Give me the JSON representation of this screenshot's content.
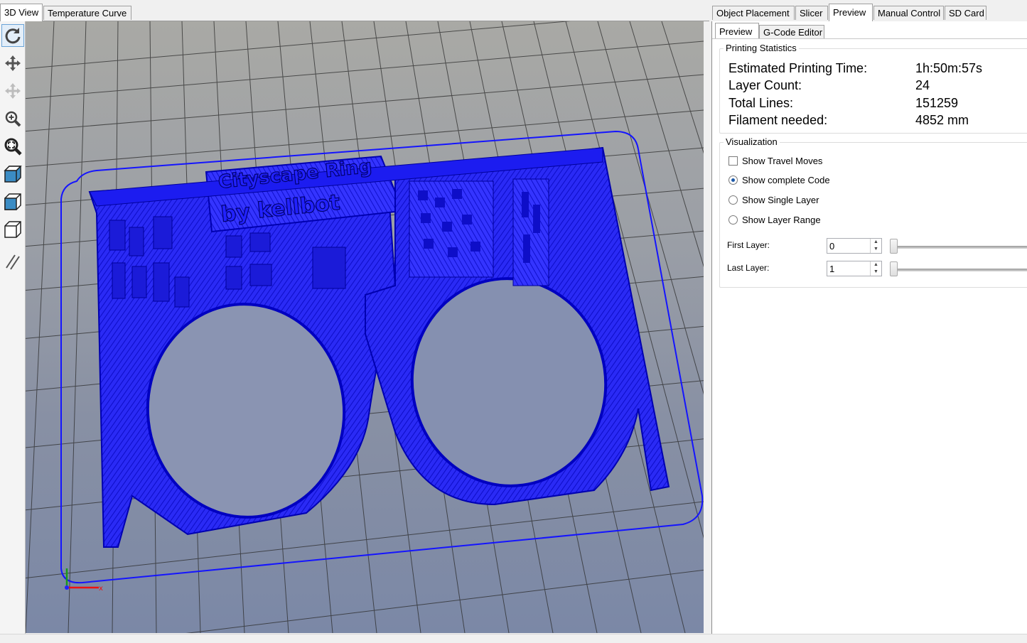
{
  "left_tabs": [
    {
      "label": "3D View",
      "active": true
    },
    {
      "label": "Temperature Curve",
      "active": false
    }
  ],
  "right_tabs": [
    {
      "label": "Object Placement",
      "active": false
    },
    {
      "label": "Slicer",
      "active": false
    },
    {
      "label": "Preview",
      "active": true
    },
    {
      "label": "Manual Control",
      "active": false
    },
    {
      "label": "SD Card",
      "active": false
    }
  ],
  "sub_tabs": [
    {
      "label": "Preview",
      "active": true
    },
    {
      "label": "G-Code Editor",
      "active": false
    }
  ],
  "toolbar": [
    {
      "name": "rotate-tool",
      "icon": "rotate-icon",
      "selected": true
    },
    {
      "name": "move-view-tool",
      "icon": "move-icon",
      "selected": false
    },
    {
      "name": "move-object-tool",
      "icon": "move-object-icon",
      "selected": false,
      "disabled": true
    },
    {
      "name": "zoom-tool",
      "icon": "zoom-icon",
      "selected": false
    },
    {
      "name": "fit-view-tool",
      "icon": "zoom-fit-icon",
      "selected": false
    },
    {
      "name": "isometric-view-tool",
      "icon": "cube-iso-icon",
      "selected": false
    },
    {
      "name": "front-view-tool",
      "icon": "cube-front-icon",
      "selected": false
    },
    {
      "name": "top-view-tool",
      "icon": "cube-top-icon",
      "selected": false
    },
    {
      "name": "parallel-projection-tool",
      "icon": "parallel-lines-icon",
      "selected": false
    }
  ],
  "model": {
    "text_line1": "Cityscape Ring",
    "text_line2": "by kellbot",
    "color": "#1a1aff"
  },
  "printing_statistics": {
    "title": "Printing Statistics",
    "rows": [
      {
        "label": "Estimated Printing Time:",
        "value": "1h:50m:57s"
      },
      {
        "label": "Layer Count:",
        "value": "24"
      },
      {
        "label": "Total Lines:",
        "value": "151259"
      },
      {
        "label": "Filament needed:",
        "value": "4852 mm"
      }
    ]
  },
  "visualization": {
    "title": "Visualization",
    "show_travel_moves": {
      "label": "Show Travel Moves",
      "checked": false
    },
    "radios": [
      {
        "label": "Show complete Code",
        "selected": true
      },
      {
        "label": "Show Single Layer",
        "selected": false
      },
      {
        "label": "Show Layer Range",
        "selected": false
      }
    ],
    "first_layer": {
      "label": "First Layer:",
      "value": "0"
    },
    "last_layer": {
      "label": "Last Layer:",
      "value": "1"
    }
  }
}
